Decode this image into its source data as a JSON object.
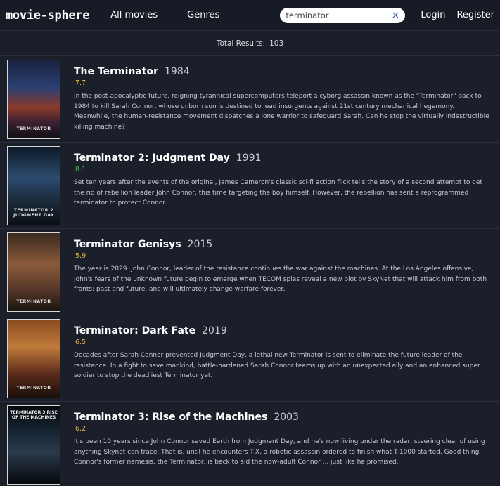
{
  "nav": {
    "logo": "movie-sphere",
    "all_movies": "All movies",
    "genres": "Genres",
    "login": "Login",
    "register": "Register"
  },
  "search": {
    "value": "terminator",
    "clear_icon": "×"
  },
  "results": {
    "label": "Total Results:",
    "count": "103"
  },
  "colors": {
    "rating_high": "#3fbf4a",
    "rating_mid": "#e0b83a"
  },
  "movies": [
    {
      "title": "The Terminator",
      "year": "1984",
      "rating": "7.7",
      "overview": "In the post-apocalyptic future, reigning tyrannical supercomputers teleport a cyborg assassin known as the \"Terminator\" back to 1984 to kill Sarah Connor, whose unborn son is destined to lead insurgents against 21st century mechanical hegemony. Meanwhile, the human-resistance movement dispatches a lone warrior to safeguard Sarah. Can he stop the virtually indestructible killing machine?",
      "poster_text": "TERMINATOR"
    },
    {
      "title": "Terminator 2: Judgment Day",
      "year": "1991",
      "rating": "8.1",
      "overview": "Set ten years after the events of the original, James Cameron's classic sci-fi action flick tells the story of a second attempt to get the rid of rebellion leader John Connor, this time targeting the boy himself. However, the rebellion has sent a reprogrammed terminator to protect Connor.",
      "poster_text": "TERMINATOR 2 JUDGMENT DAY"
    },
    {
      "title": "Terminator Genisys",
      "year": "2015",
      "rating": "5.9",
      "overview": "The year is 2029. John Connor, leader of the resistance continues the war against the machines. At the Los Angeles offensive, John's fears of the unknown future begin to emerge when TECOM spies reveal a new plot by SkyNet that will attack him from both fronts; past and future, and will ultimately change warfare forever.",
      "poster_text": "TERMINATOR"
    },
    {
      "title": "Terminator: Dark Fate",
      "year": "2019",
      "rating": "6.5",
      "overview": "Decades after Sarah Connor prevented Judgment Day, a lethal new Terminator is sent to eliminate the future leader of the resistance. In a fight to save mankind, battle-hardened Sarah Connor teams up with an unexpected ally and an enhanced super soldier to stop the deadliest Terminator yet.",
      "poster_text": "TERMINATOR"
    },
    {
      "title": "Terminator 3: Rise of the Machines",
      "year": "2003",
      "rating": "6.2",
      "overview": "It's been 10 years since John Connor saved Earth from Judgment Day, and he's now living under the radar, steering clear of using anything Skynet can trace. That is, until he encounters T-X, a robotic assassin ordered to finish what T-1000 started. Good thing Connor's former nemesis, the Terminator, is back to aid the now-adult Connor ... just like he promised.",
      "poster_text": "TERMINATOR 3 RISE OF THE MACHINES"
    }
  ]
}
